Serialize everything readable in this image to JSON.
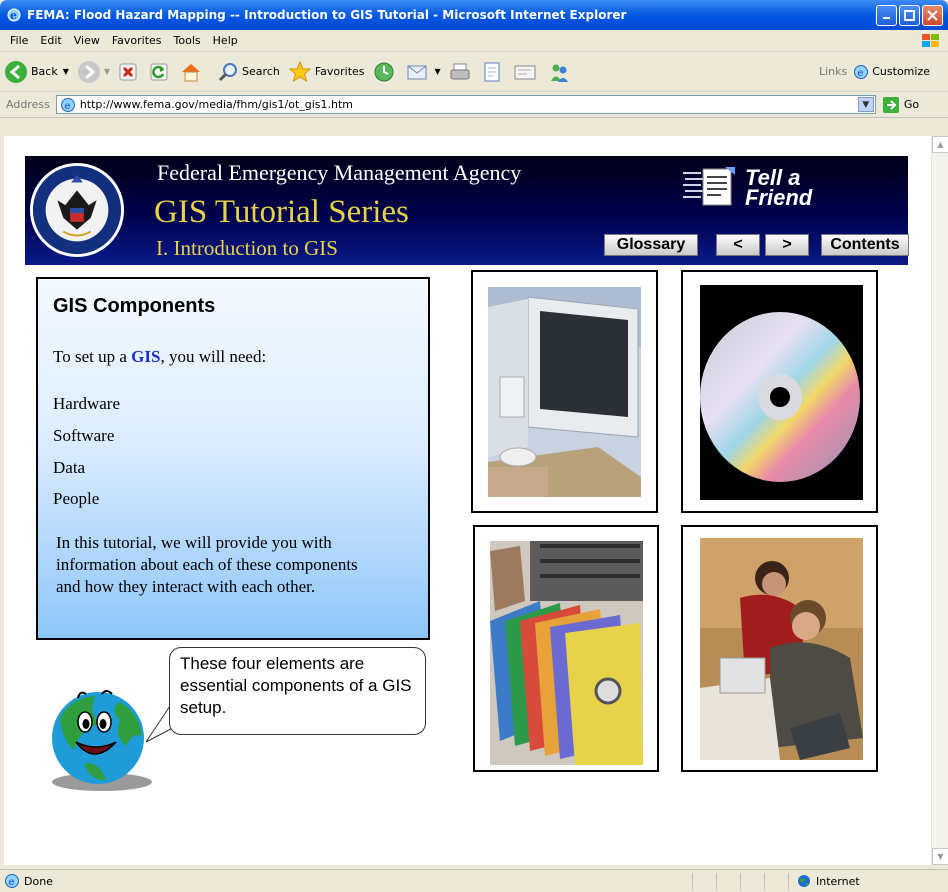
{
  "window": {
    "title": "FEMA: Flood Hazard Mapping -- Introduction to GIS Tutorial - Microsoft Internet Explorer"
  },
  "menu": [
    "File",
    "Edit",
    "View",
    "Favorites",
    "Tools",
    "Help"
  ],
  "toolbar": {
    "back": "Back",
    "search": "Search",
    "favorites": "Favorites",
    "links": "Links",
    "customize": "Customize"
  },
  "address": {
    "label": "Address",
    "url": "http://www.fema.gov/media/fhm/gis1/ot_gis1.htm",
    "go": "Go"
  },
  "banner": {
    "agency": "Federal Emergency Management Agency",
    "series": "GIS Tutorial Series",
    "subtitle": "I. Introduction to GIS",
    "tell_line1": "Tell a",
    "tell_line2": "Friend",
    "glossary": "Glossary",
    "prev": "<",
    "next": ">",
    "contents": "Contents"
  },
  "panel": {
    "heading": "GIS Components",
    "intro_before": "To set up a ",
    "intro_link": "GIS",
    "intro_after": ", you will need:",
    "items": [
      "Hardware",
      "Software",
      "Data",
      "People"
    ],
    "paragraph": "In this tutorial, we will provide you with information about each of these components and how they interact with each other."
  },
  "bubble": {
    "text": "These four elements are essential components of a GIS setup."
  },
  "status": {
    "text": "Done",
    "zone": "Internet"
  }
}
